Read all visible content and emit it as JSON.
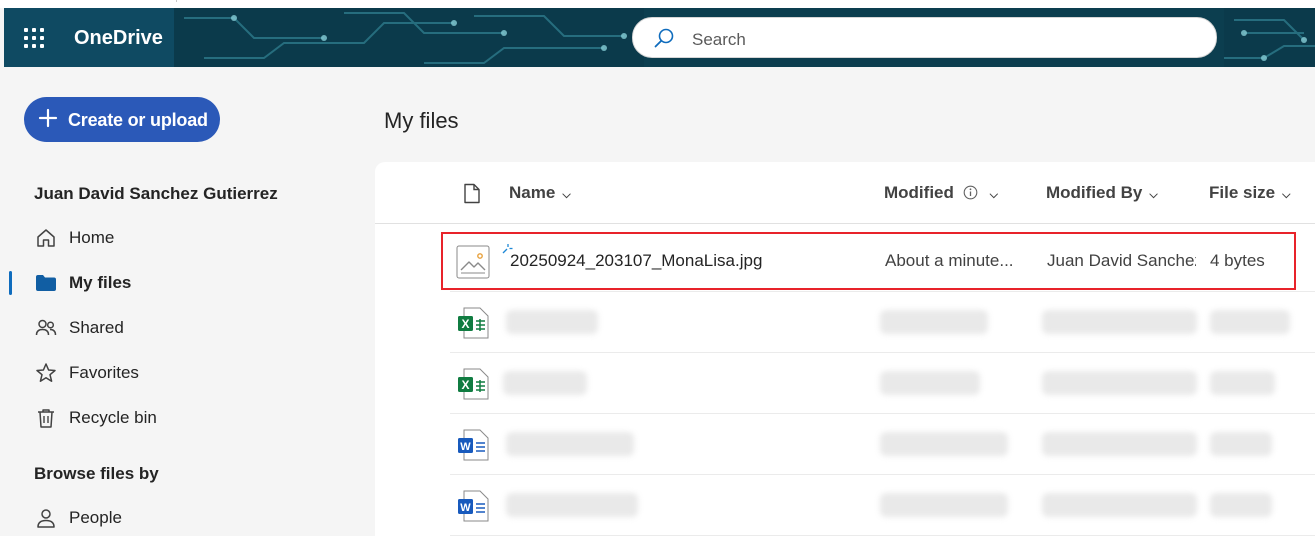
{
  "app": {
    "name": "OneDrive"
  },
  "search": {
    "placeholder": "Search"
  },
  "sidebar": {
    "create_label": "Create or upload",
    "user_name": "Juan David Sanchez Gutierrez",
    "items": [
      {
        "label": "Home",
        "icon": "home-icon"
      },
      {
        "label": "My files",
        "icon": "folder-icon",
        "active": true
      },
      {
        "label": "Shared",
        "icon": "people-icon"
      },
      {
        "label": "Favorites",
        "icon": "star-icon"
      },
      {
        "label": "Recycle bin",
        "icon": "trash-icon"
      }
    ],
    "browse_title": "Browse files by",
    "browse_items": [
      {
        "label": "People",
        "icon": "person-icon"
      }
    ]
  },
  "main": {
    "title": "My files",
    "columns": {
      "name": "Name",
      "modified": "Modified",
      "modified_by": "Modified By",
      "file_size": "File size"
    },
    "files": [
      {
        "name": "20250924_203107_MonaLisa.jpg",
        "type": "image",
        "modified": "About a minute...",
        "modified_by": "Juan David Sanchez",
        "size": "4 bytes",
        "highlighted": true
      },
      {
        "name": "",
        "type": "excel",
        "blurred": true
      },
      {
        "name": "",
        "type": "excel",
        "blurred": true
      },
      {
        "name": "",
        "type": "word",
        "blurred": true
      },
      {
        "name": "",
        "type": "word",
        "blurred": true
      }
    ]
  },
  "colors": {
    "header_bg": "#0b3a4b",
    "brand_bg": "#0f4a62",
    "accent": "#2b59b8",
    "highlight": "#e8232a",
    "excel": "#107c41",
    "word": "#185abd"
  }
}
